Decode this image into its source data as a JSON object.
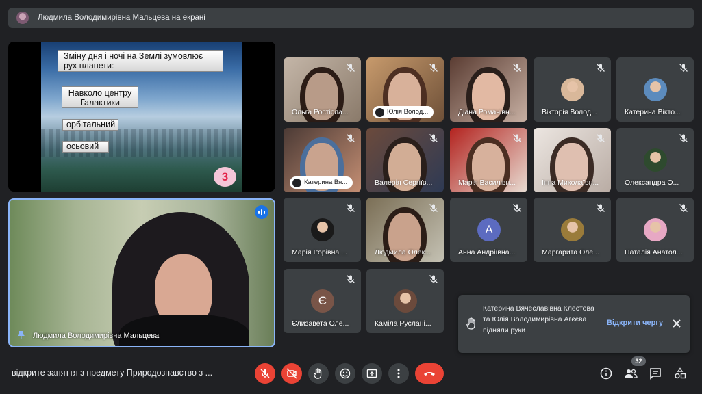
{
  "topbar": {
    "presenting_text": "Людмила Володимирівна Мальцева на екрані"
  },
  "slide": {
    "question": "Зміну дня і ночі на Землі зумовлює рух планети:",
    "option1": "Навколо центру Галактики",
    "option2": "орбітальний",
    "option3": "осьовий",
    "number": "3"
  },
  "self_tile": {
    "name": "Людмила Володимирівна Мальцева"
  },
  "participants": [
    {
      "name": "Ольга Ростісла...",
      "type": "video"
    },
    {
      "name": "Юлія Волод...",
      "type": "video",
      "hand_raised": true
    },
    {
      "name": "Діана Романівн...",
      "type": "video"
    },
    {
      "name": "Вікторія Волод...",
      "type": "avatar"
    },
    {
      "name": "Катерина Вікто...",
      "type": "avatar"
    },
    {
      "name": "Катерина Вя...",
      "type": "video",
      "hand_raised": true
    },
    {
      "name": "Валерія Сергіїв...",
      "type": "video"
    },
    {
      "name": "Марія Василівн...",
      "type": "video"
    },
    {
      "name": "Інна Миколаївн...",
      "type": "video"
    },
    {
      "name": "Олександра О...",
      "type": "avatar"
    },
    {
      "name": "Марія Ігорівна ...",
      "type": "avatar"
    },
    {
      "name": "Людмила Олек...",
      "type": "video"
    },
    {
      "name": "Анна Андріївна...",
      "type": "letter",
      "letter": "A",
      "color": "#5c6bc0"
    },
    {
      "name": "Маргарита Оле...",
      "type": "avatar"
    },
    {
      "name": "Наталія Анатол...",
      "type": "avatar"
    },
    {
      "name": "Єлизавета Оле...",
      "type": "letter",
      "letter": "Є",
      "color": "#795548"
    },
    {
      "name": "Каміла Руслані...",
      "type": "avatar"
    }
  ],
  "toast": {
    "message": "Катерина Вячеславівна Клестова та Юлія Володимирівна Агєєва підняли руки",
    "action": "Відкрити чергу"
  },
  "bottom": {
    "meeting_title": "відкрите заняття з предмету Природознавство з ...",
    "participant_count": "32"
  },
  "colors": {
    "accent": "#8ab4f8",
    "danger": "#ea4335",
    "tile_bg": "#3c4043",
    "bg": "#202124"
  }
}
